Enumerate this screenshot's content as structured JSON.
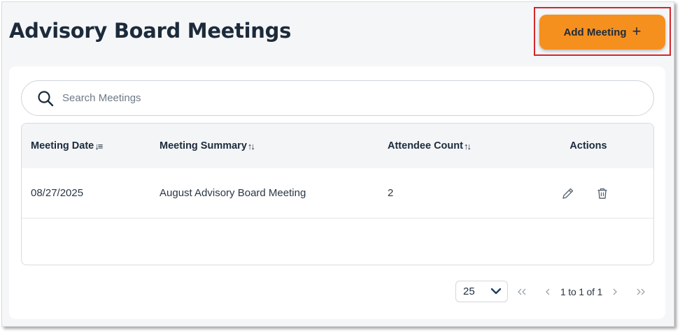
{
  "header": {
    "title": "Advisory Board Meetings",
    "add_button_label": "Add Meeting",
    "add_button_icon": "plus-icon"
  },
  "search": {
    "placeholder": "Search Meetings",
    "value": "",
    "icon": "search-icon"
  },
  "table": {
    "columns": [
      {
        "label": "Meeting Date",
        "sort": "↓≡"
      },
      {
        "label": "Meeting Summary",
        "sort": "↑↓"
      },
      {
        "label": "Attendee Count",
        "sort": "↑↓"
      },
      {
        "label": "Actions",
        "sort": ""
      }
    ],
    "rows": [
      {
        "date": "08/27/2025",
        "summary": "August Advisory Board Meeting",
        "attendees": "2",
        "actions": [
          "pencil-icon",
          "trash-icon"
        ]
      }
    ]
  },
  "pagination": {
    "page_size": "25",
    "range_text": "1 to 1 of 1"
  },
  "colors": {
    "accent": "#f5901f",
    "highlight": "#d4262c",
    "title": "#1c2b3b"
  }
}
